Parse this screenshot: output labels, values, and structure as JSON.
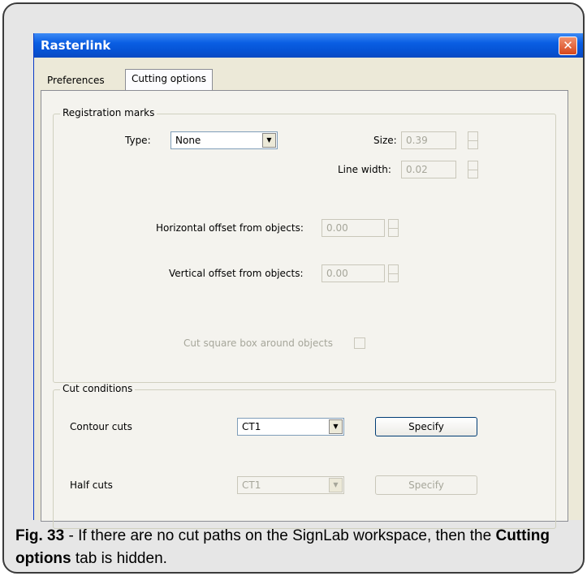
{
  "window": {
    "title": "Rasterlink",
    "close_symbol": "✕"
  },
  "tabs": [
    {
      "label": "Preferences"
    },
    {
      "label": "Cutting options"
    }
  ],
  "registration": {
    "legend": "Registration marks",
    "type_label": "Type:",
    "type_value": "None",
    "size_label": "Size:",
    "size_value": "0.39",
    "line_width_label": "Line width:",
    "line_width_value": "0.02",
    "h_offset_label": "Horizontal offset from objects:",
    "h_offset_value": "0.00",
    "v_offset_label": "Vertical offset from objects:",
    "v_offset_value": "0.00",
    "cut_box_label": "Cut square box around objects"
  },
  "cut_conditions": {
    "legend": "Cut conditions",
    "contour_label": "Contour cuts",
    "contour_value": "CT1",
    "contour_button": "Specify",
    "half_label": "Half cuts",
    "half_value": "CT1",
    "half_button": "Specify"
  },
  "caption": {
    "fig": "Fig. 33",
    "text1": " - If there are no cut paths on the SignLab workspace, then the ",
    "bold": "Cutting options",
    "text2": " tab is hidden."
  }
}
